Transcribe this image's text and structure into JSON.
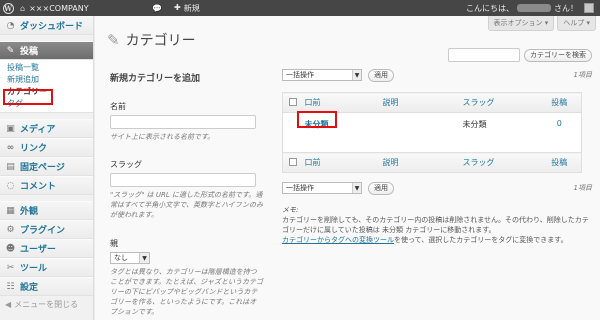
{
  "adminbar": {
    "site_name": "×××COMPANY",
    "comment_icon": "speech-bubble-icon",
    "new_label": "新規",
    "greeting_prefix": "こんにちは、",
    "greeting_suffix": "さん！"
  },
  "sidebar": {
    "dashboard": "ダッシュボード",
    "posts": "投稿",
    "posts_sub": [
      "投稿一覧",
      "新規追加",
      "カテゴリー",
      "タグ"
    ],
    "media": "メディア",
    "links": "リンク",
    "pages": "固定ページ",
    "comments": "コメント",
    "appearance": "外観",
    "plugins": "プラグイン",
    "users": "ユーザー",
    "tools": "ツール",
    "settings": "設定",
    "collapse": "メニューを閉じる"
  },
  "screen_options": "表示オプション ▾",
  "help": "ヘルプ ▾",
  "page_title": "カテゴリー",
  "search_button": "カテゴリーを検索",
  "form": {
    "heading": "新規カテゴリーを追加",
    "name_label": "名前",
    "name_help": "サイト上に表示される名前です。",
    "slug_label": "スラッグ",
    "slug_help": "\"スラッグ\" は URL に適した形式の名前です。通常はすべて半角小文字で、英数字とハイフンのみが使われます。",
    "parent_label": "親",
    "parent_value": "なし",
    "parent_help": "タグとは異なり、カテゴリーは階層構造を持つことができます。たとえば、ジャズというカテゴリーの下にビバップやビッグバンドというカテゴリーを作る、といったようにです。これはオプションです。"
  },
  "table": {
    "bulk_action": "一括操作",
    "apply": "適用",
    "item_count": "1項目",
    "headers": [
      "口前",
      "説明",
      "スラッグ",
      "投稿"
    ],
    "rows": [
      {
        "name": "未分類",
        "description": "",
        "slug": "未分類",
        "count": "0"
      }
    ]
  },
  "memo": {
    "label": "メモ:",
    "text1": "カテゴリーを削除しても、そのカテゴリー内の投稿は削除されません。その代わり、削除したカテゴリーだけに属していた投稿は 未分類 カテゴリーに移動されます。",
    "link": "カテゴリーからタグへの変換ツール",
    "text2": "を使って、選択したカテゴリーをタグに変換できます。"
  },
  "colors": {
    "highlight": "#e01010",
    "link": "#21759b",
    "adminbar": "#464646"
  }
}
